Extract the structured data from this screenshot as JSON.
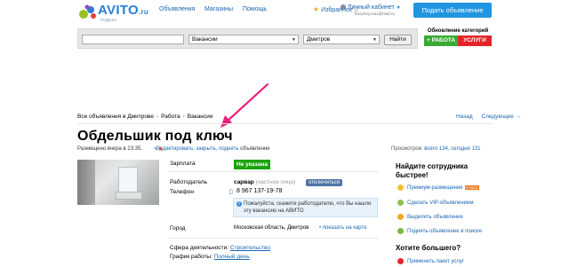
{
  "header": {
    "logo_text": "AVITO",
    "logo_domain": ".ru",
    "logo_sub": "ПОДСКА",
    "nav": [
      "Объявления",
      "Магазины",
      "Помощь"
    ],
    "favorites_label": "Избранное",
    "favorites_count": "0",
    "cabinet_label": "Личный кабинет",
    "cabinet_email": "ferachey.max@mail.ru",
    "post_ad_label": "Подать объявление"
  },
  "search": {
    "query_value": "",
    "category_value": "Вакансии",
    "region_value": "Дмитров",
    "find_label": "Найти"
  },
  "category_update": {
    "title": "Обновление категорий",
    "work_label": "+ РАБОТА",
    "services_label": "УСЛУГИ"
  },
  "breadcrumb": {
    "items": [
      "Все объявления в Дмитрове",
      "Работа",
      "Вакансии"
    ],
    "back_label": "Назад",
    "next_label": "Следующее"
  },
  "ad": {
    "title": "Обдельшик под ключ",
    "posted": "Размещено вчера в 23:35.",
    "edit_label": "Редактировать, закрыть, поднять",
    "edit_suffix": "объявление",
    "views_label": "Просмотров:",
    "views_value": "всего 134, сегодня 131",
    "salary_label": "Зарплата",
    "salary_value": "Не указана",
    "employer_label": "Работодатель",
    "employer_name": "сарвар",
    "employer_type": "(частное лицо)",
    "unsubscribe_label": "отключиться",
    "phone_label": "Телефон",
    "phone_value": "8 967 137-19-78",
    "info_text": "Пожалуйста, скажите работодателю, что Вы нашли эту вакансию на АВИТО",
    "city_label": "Город",
    "city_value": "Московская область, Дмитров",
    "map_label": "показать на карте",
    "sphere_label": "Сфера деятельности:",
    "sphere_value": "Строительство",
    "schedule_label": "График работы:",
    "schedule_value": "Полный день"
  },
  "sidebar": {
    "title": "Найдите сотрудника быстрее!",
    "items": [
      {
        "label": "Премиум-размещение",
        "badge": "НОВОЕ"
      },
      {
        "label": "Сделать VIP-объявлением",
        "badge": ""
      },
      {
        "label": "Выделить объявление",
        "badge": ""
      },
      {
        "label": "Поднять объявление в поиске",
        "badge": ""
      }
    ],
    "title2": "Хотите большего?",
    "extra_item": "Применить пакет услуг"
  },
  "colors": {
    "brand_blue": "#2196e0",
    "link_blue": "#1a66b3",
    "green": "#1aa30c",
    "red": "#e3242b",
    "arrow": "#e91e7d"
  }
}
